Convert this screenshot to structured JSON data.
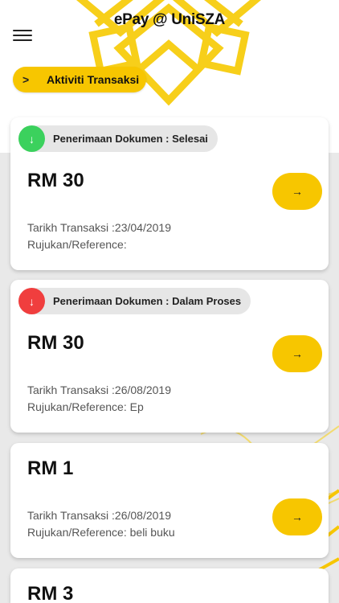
{
  "app": {
    "title": "ePay @ UniSZA"
  },
  "header": {
    "menu_icon": "hamburger-menu-icon",
    "activity_button": {
      "chevron": ">",
      "label": "Aktiviti Transaksi"
    }
  },
  "colors": {
    "accent": "#f7c600",
    "status_done": "#3bd15d",
    "status_pending": "#f03e3e",
    "pill_bg": "#e6e6e6"
  },
  "transactions": [
    {
      "status_icon": "arrow-down-icon",
      "status_glyph": "↓",
      "status_label": "Penerimaan Dokumen : Selesai",
      "amount": "RM 30",
      "date_line": "Tarikh Transaksi :23/04/2019",
      "ref_line": "Rujukan/Reference:",
      "arrow": "→"
    },
    {
      "status_icon": "arrow-down-icon",
      "status_glyph": "↓",
      "status_label": "Penerimaan Dokumen : Dalam Proses",
      "amount": "RM 30",
      "date_line": "Tarikh Transaksi :26/08/2019",
      "ref_line": "Rujukan/Reference: Ep",
      "arrow": "→"
    },
    {
      "amount": "RM 1",
      "date_line": "Tarikh Transaksi :26/08/2019",
      "ref_line": "Rujukan/Reference: beli buku",
      "arrow": "→"
    },
    {
      "amount": "RM 3"
    }
  ]
}
